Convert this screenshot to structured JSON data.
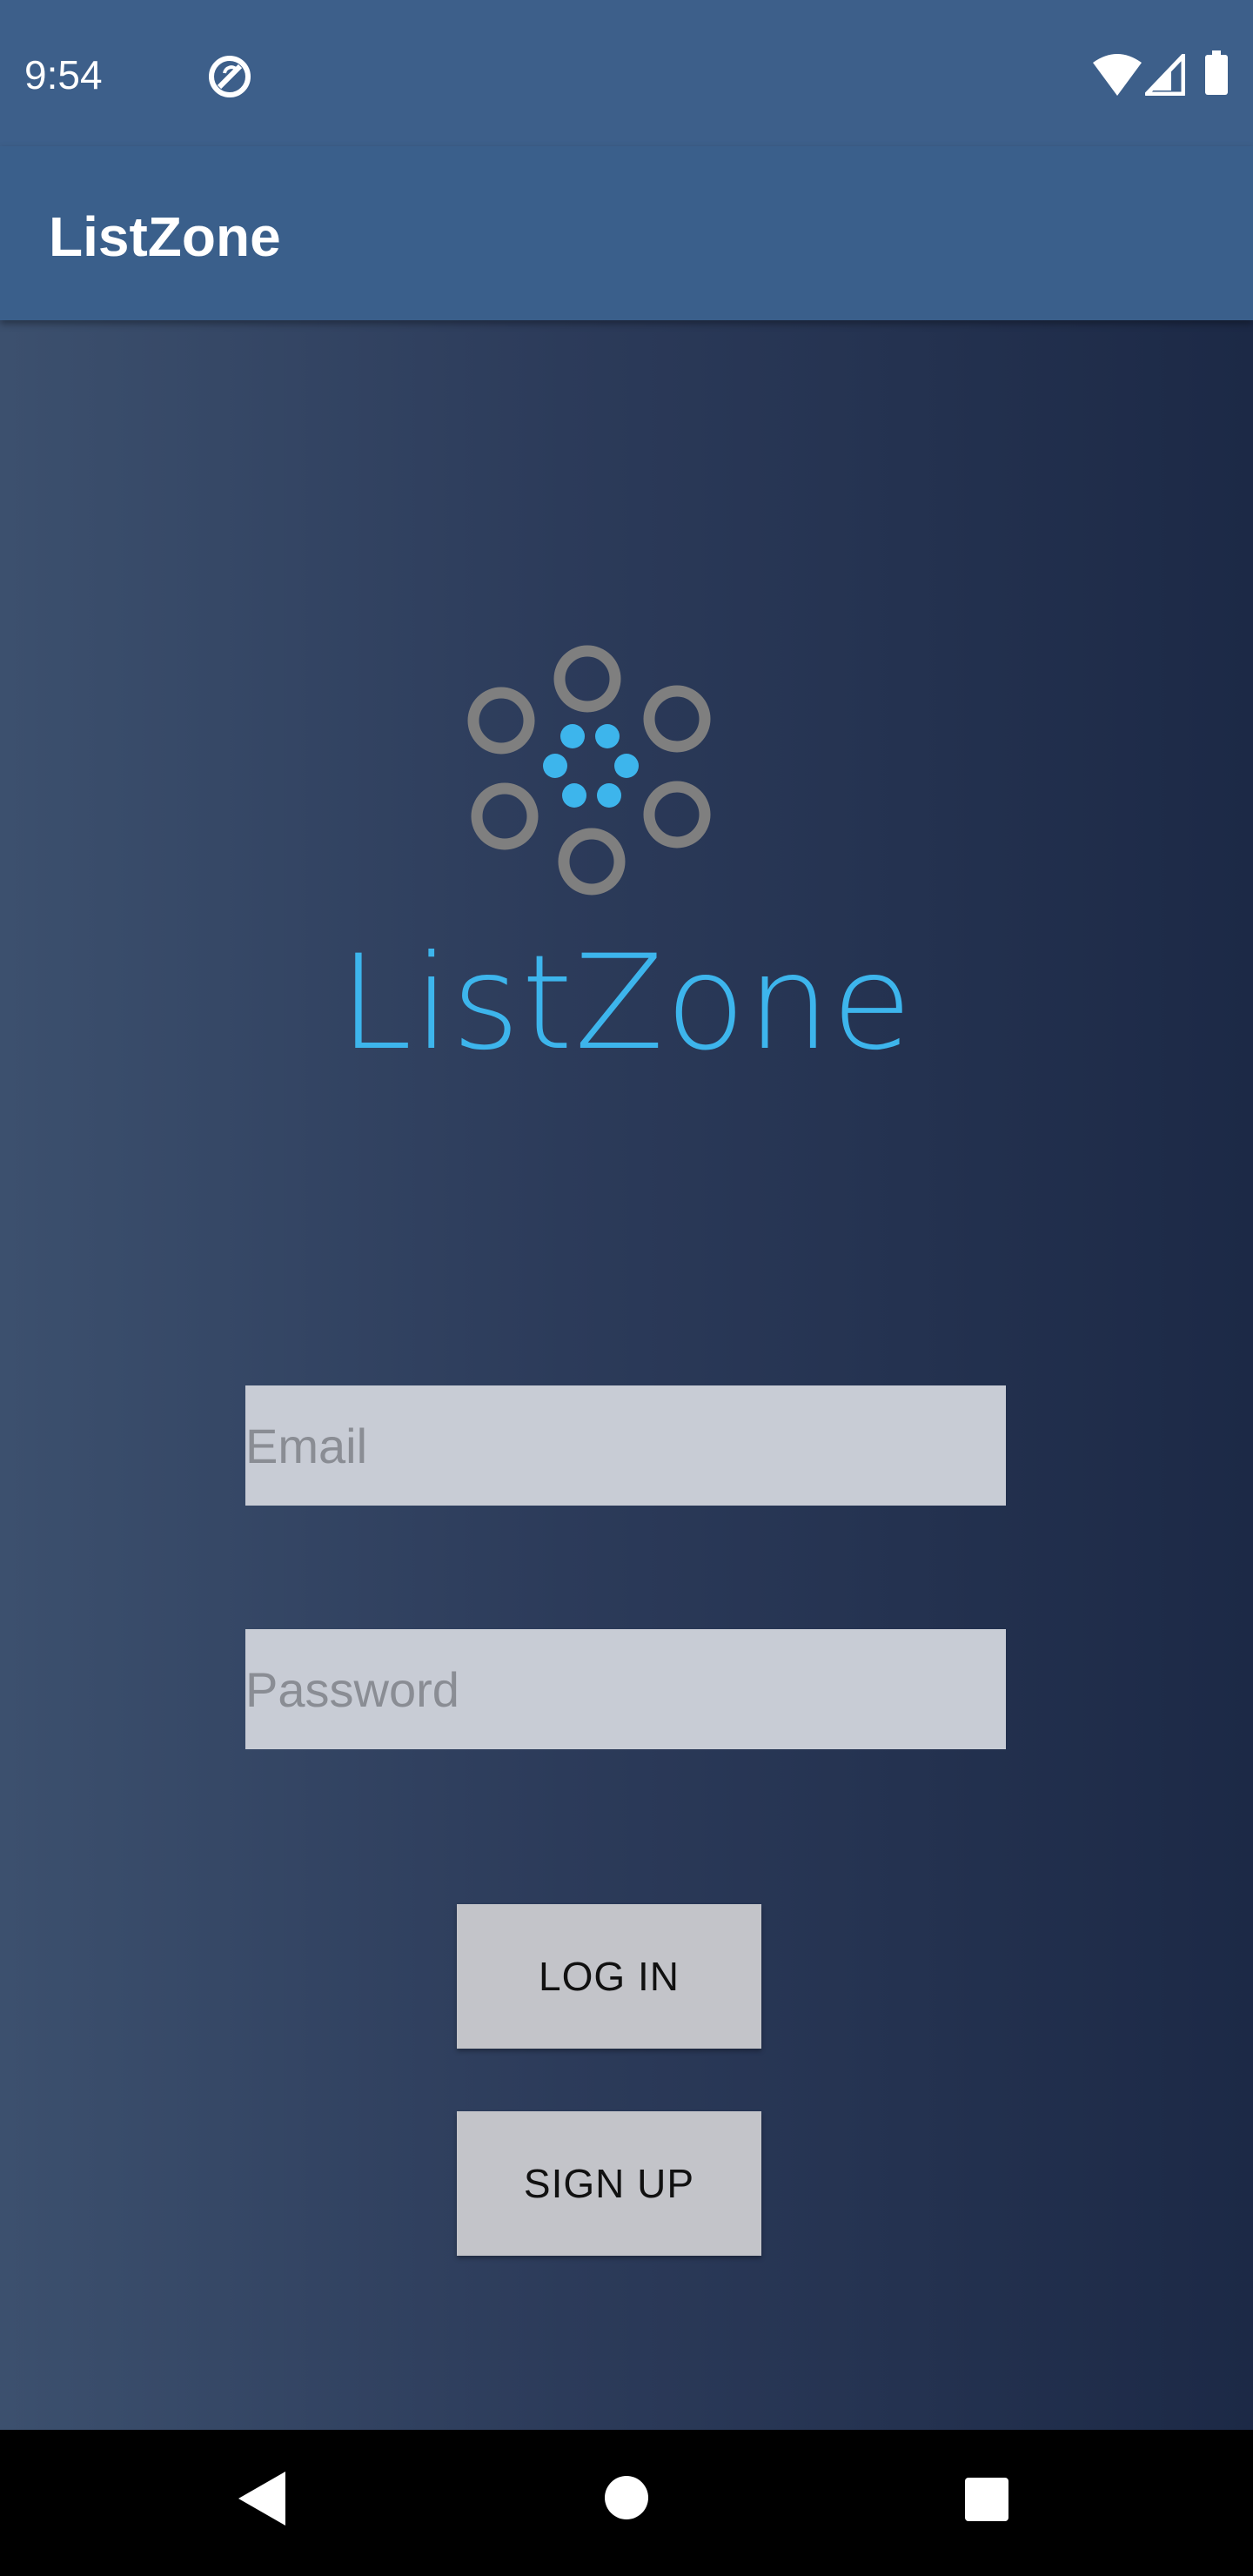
{
  "status_bar": {
    "time": "9:54",
    "icons": [
      "data-saver-icon",
      "wifi-icon",
      "cell-signal-icon",
      "battery-icon"
    ]
  },
  "app_bar": {
    "title": "ListZone"
  },
  "logo": {
    "brand_text": "ListZone",
    "colors": {
      "ring": "#7f7f7f",
      "dot": "#3db5ec"
    }
  },
  "form": {
    "email_placeholder": "Email",
    "email_value": "",
    "password_placeholder": "Password",
    "password_value": "",
    "login_label": "LOG IN",
    "signup_label": "SIGN UP"
  },
  "nav_bar": {
    "icons": [
      "back-icon",
      "home-icon",
      "recents-icon"
    ]
  },
  "colors": {
    "status_bar": "#3d5f8a",
    "app_bar": "#3a5f8b",
    "background_left": "#3c506e",
    "background_right": "#1c2946",
    "input_bg": "#c8ccd5",
    "button_bg": "#c3c4c9"
  }
}
